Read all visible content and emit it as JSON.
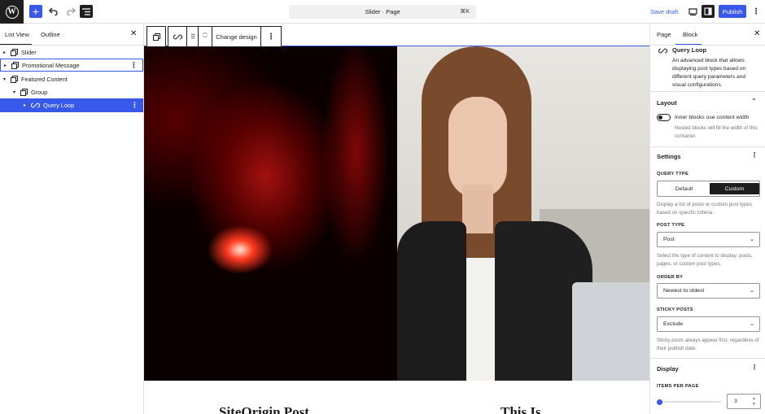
{
  "topbar": {
    "logo_letter": "W",
    "add_icon": "plus-icon",
    "undo_icon": "undo-icon",
    "redo_icon": "redo-icon",
    "document_overview_icon": "list-view-icon",
    "command_title": "Slider · Page",
    "command_shortcut": "⌘K",
    "save_draft_label": "Save draft",
    "view_icon": "desktop-view-icon",
    "settings_icon": "sidebar-settings-icon",
    "publish_label": "Publish",
    "more_icon": "vertical-ellipsis-icon"
  },
  "left_panel": {
    "tabs": [
      {
        "label": "List View",
        "active": true
      },
      {
        "label": "Outline",
        "active": false
      }
    ],
    "close_icon": "close-icon",
    "items": [
      {
        "label": "Slider",
        "level": 0,
        "chevron": "›",
        "icon": "block-icon",
        "state": "normal"
      },
      {
        "label": "Promotional Message",
        "level": 0,
        "chevron": "›",
        "icon": "block-icon",
        "state": "outlined",
        "menu": "⋮"
      },
      {
        "label": "Featured Content",
        "level": 0,
        "chevron": "⌄",
        "icon": "block-icon",
        "state": "normal"
      },
      {
        "label": "Group",
        "level": 1,
        "chevron": "⌄",
        "icon": "group-icon",
        "state": "normal"
      },
      {
        "label": "Query Loop",
        "level": 2,
        "chevron": "›",
        "icon": "loop-icon",
        "state": "selected",
        "menu": "⋮"
      }
    ]
  },
  "canvas": {
    "block_toolbar": {
      "parent_icon": "select-parent-icon",
      "block_icon": "loop-icon",
      "drag_icon": "drag-handle-icon",
      "move_icon": "move-up-down-icon",
      "change_design_label": "Change design",
      "options_icon": "vertical-ellipsis-icon"
    },
    "posts": [
      {
        "title": "SiteOrigin Post"
      },
      {
        "title": "This Is"
      }
    ]
  },
  "right_panel": {
    "tabs": [
      {
        "label": "Page",
        "active": false
      },
      {
        "label": "Block",
        "active": true
      }
    ],
    "close_icon": "close-icon",
    "block": {
      "icon": "loop-icon",
      "name": "Query Loop",
      "description": "An advanced block that allows displaying post types based on different query parameters and visual configurations."
    },
    "layout": {
      "title": "Layout",
      "collapse_icon": "chevron-up-icon",
      "toggle_label": "Inner blocks use content width",
      "toggle_on": false,
      "help": "Nested blocks will fill the width of this container."
    },
    "settings": {
      "title": "Settings",
      "menu_icon": "vertical-ellipsis-icon",
      "query_type_label": "QUERY TYPE",
      "query_type_options": [
        "Default",
        "Custom"
      ],
      "query_type_selected": "Custom",
      "query_type_help": "Display a list of posts or custom post types based on specific criteria.",
      "post_type_label": "POST TYPE",
      "post_type_value": "Post",
      "post_type_help": "Select the type of content to display: posts, pages, or custom post types.",
      "order_by_label": "ORDER BY",
      "order_by_value": "Newest to oldest",
      "sticky_label": "STICKY POSTS",
      "sticky_value": "Exclude",
      "sticky_help": "Sticky posts always appear first, regardless of their publish date."
    },
    "display": {
      "title": "Display",
      "menu_icon": "vertical-ellipsis-icon",
      "items_per_page_label": "ITEMS PER PAGE",
      "items_per_page_value": "3",
      "slider_fraction": 0.03
    }
  },
  "colors": {
    "accent": "#3858e9",
    "dark": "#1e1e1e",
    "border": "#e0e0e0",
    "muted_text": "#757575"
  }
}
